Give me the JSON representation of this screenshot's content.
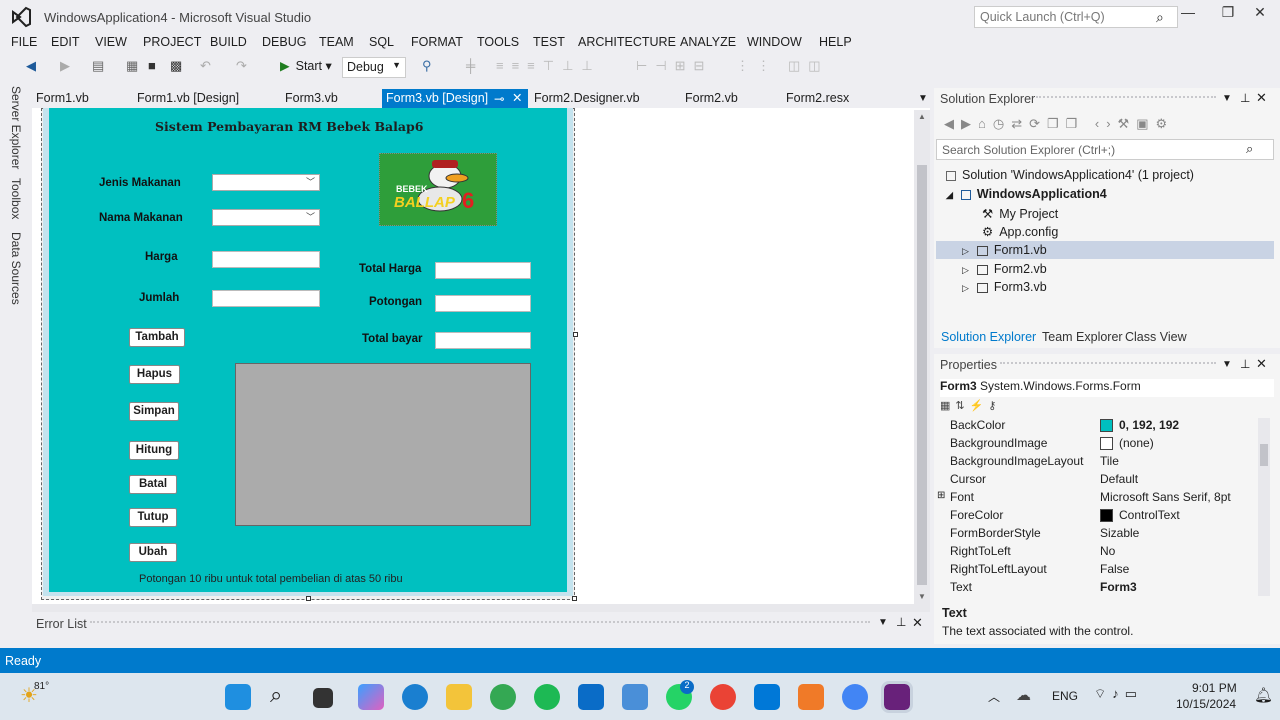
{
  "window": {
    "title": "WindowsApplication4 - Microsoft Visual Studio",
    "quick_launch_placeholder": "Quick Launch (Ctrl+Q)"
  },
  "menu": [
    "FILE",
    "EDIT",
    "VIEW",
    "PROJECT",
    "BUILD",
    "DEBUG",
    "TEAM",
    "SQL",
    "FORMAT",
    "TOOLS",
    "TEST",
    "ARCHITECTURE",
    "ANALYZE",
    "WINDOW",
    "HELP"
  ],
  "toolbar": {
    "start_label": "Start",
    "config": "Debug"
  },
  "side_tabs": [
    "Server Explorer",
    "Toolbox",
    "Data Sources"
  ],
  "doc_tabs": [
    "Form1.vb",
    "Form1.vb [Design]",
    "Form3.vb",
    "Form3.vb [Design]",
    "Form2.Designer.vb",
    "Form2.vb",
    "Form2.resx"
  ],
  "form": {
    "title": "Sistem Pembayaran RM Bebek Balap6",
    "jenis_makanan": "Jenis Makanan",
    "nama_makanan": "Nama Makanan",
    "harga": "Harga",
    "jumlah": "Jumlah",
    "total_harga": "Total Harga",
    "potongan": "Potongan",
    "total_bayar": "Total bayar",
    "buttons": [
      "Tambah",
      "Hapus",
      "Simpan",
      "Hitung",
      "Batal",
      "Tutup",
      "Ubah"
    ],
    "note": "Potongan 10 ribu untuk total pembelian di atas 50 ribu",
    "logo_text_1": "BEBEK",
    "logo_text_2": "BALLAP",
    "logo_text_3": "6"
  },
  "error_list": {
    "title": "Error List"
  },
  "solution_explorer": {
    "title": "Solution Explorer",
    "search_placeholder": "Search Solution Explorer (Ctrl+;)",
    "tree": [
      "Solution 'WindowsApplication4' (1 project)",
      "WindowsApplication4",
      "My Project",
      "App.config",
      "Form1.vb",
      "Form2.vb",
      "Form3.vb"
    ],
    "tabs": [
      "Solution Explorer",
      "Team Explorer",
      "Class View"
    ]
  },
  "properties": {
    "title": "Properties",
    "object": "Form3",
    "object_type": "System.Windows.Forms.Form",
    "rows": [
      {
        "name": "BackColor",
        "value": "0, 192, 192"
      },
      {
        "name": "BackgroundImage",
        "value": "(none)"
      },
      {
        "name": "BackgroundImageLayout",
        "value": "Tile"
      },
      {
        "name": "Cursor",
        "value": "Default"
      },
      {
        "name": "Font",
        "value": "Microsoft Sans Serif, 8pt"
      },
      {
        "name": "ForeColor",
        "value": "ControlText"
      },
      {
        "name": "FormBorderStyle",
        "value": "Sizable"
      },
      {
        "name": "RightToLeft",
        "value": "No"
      },
      {
        "name": "RightToLeftLayout",
        "value": "False"
      },
      {
        "name": "Text",
        "value": "Form3"
      }
    ],
    "desc_title": "Text",
    "desc_body": "The text associated with the control.",
    "backcolor_swatch": "#00c0c0",
    "forecolor_swatch": "#000000"
  },
  "status": {
    "text": "Ready"
  },
  "taskbar": {
    "weather_temp": "81°",
    "lang": "ENG",
    "time": "9:01 PM",
    "date": "10/15/2024",
    "whatsapp_badge": "2"
  }
}
